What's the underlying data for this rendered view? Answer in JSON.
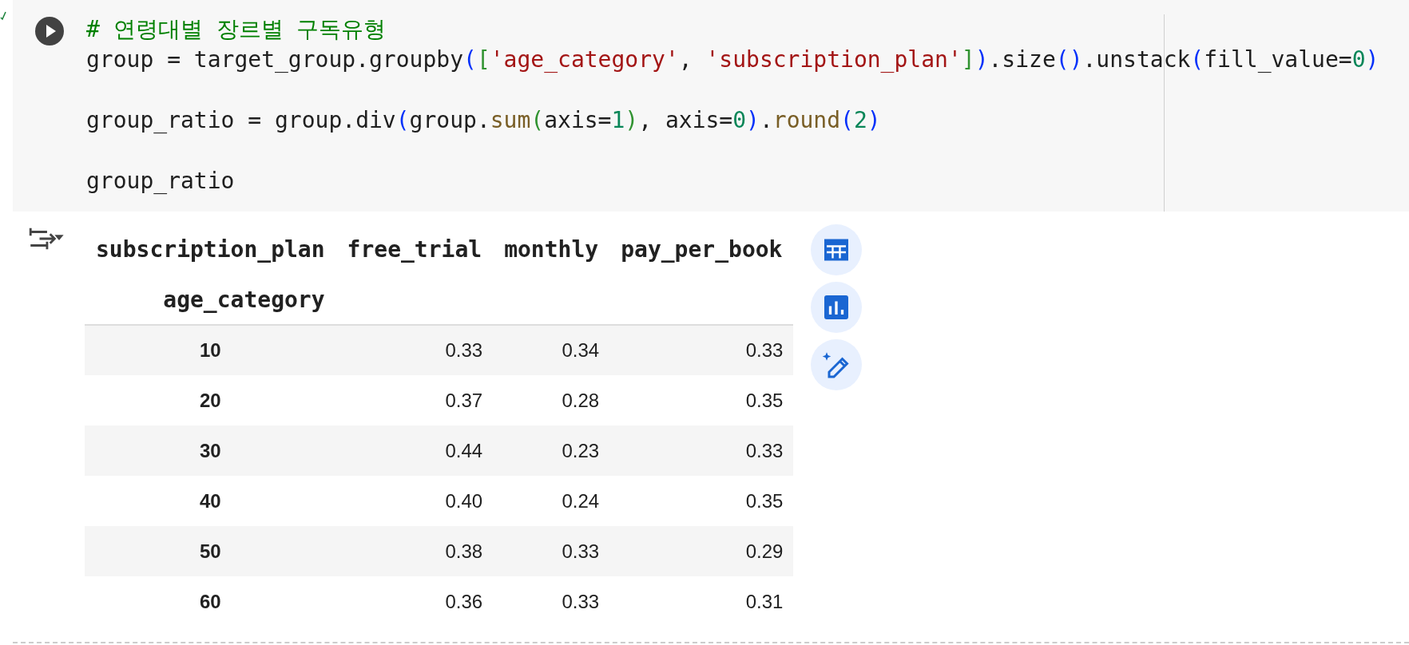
{
  "code_cell": {
    "lines": [
      {
        "kind": "code",
        "tokens": [
          {
            "kind": "comment",
            "text": "# 연령대별 장르별 구독유형"
          }
        ]
      },
      {
        "kind": "code",
        "tokens": [
          {
            "kind": "plain",
            "text": "group = target_group.groupby"
          },
          {
            "kind": "paren",
            "text": "("
          },
          {
            "kind": "bracket",
            "text": "["
          },
          {
            "kind": "string",
            "text": "'age_category'"
          },
          {
            "kind": "plain",
            "text": ", "
          },
          {
            "kind": "string",
            "text": "'subscription_plan'"
          },
          {
            "kind": "bracket",
            "text": "]"
          },
          {
            "kind": "paren",
            "text": ")"
          },
          {
            "kind": "plain",
            "text": ".size"
          },
          {
            "kind": "paren",
            "text": "()"
          },
          {
            "kind": "plain",
            "text": ".unstack"
          },
          {
            "kind": "paren",
            "text": "("
          },
          {
            "kind": "plain",
            "text": "fill_value="
          },
          {
            "kind": "number",
            "text": "0"
          },
          {
            "kind": "paren",
            "text": ")"
          }
        ]
      },
      {
        "kind": "blank"
      },
      {
        "kind": "code",
        "tokens": [
          {
            "kind": "plain",
            "text": "group_ratio = group.div"
          },
          {
            "kind": "paren",
            "text": "("
          },
          {
            "kind": "plain",
            "text": "group."
          },
          {
            "kind": "func",
            "text": "sum"
          },
          {
            "kind": "bracket",
            "text": "("
          },
          {
            "kind": "plain",
            "text": "axis="
          },
          {
            "kind": "number",
            "text": "1"
          },
          {
            "kind": "bracket",
            "text": ")"
          },
          {
            "kind": "plain",
            "text": ", axis="
          },
          {
            "kind": "number",
            "text": "0"
          },
          {
            "kind": "paren",
            "text": ")"
          },
          {
            "kind": "plain",
            "text": "."
          },
          {
            "kind": "func",
            "text": "round"
          },
          {
            "kind": "paren",
            "text": "("
          },
          {
            "kind": "number",
            "text": "2"
          },
          {
            "kind": "paren",
            "text": ")"
          }
        ]
      },
      {
        "kind": "blank"
      },
      {
        "kind": "code",
        "tokens": [
          {
            "kind": "plain",
            "text": "group_ratio"
          }
        ]
      }
    ]
  },
  "output_table": {
    "columns_name": "subscription_plan",
    "index_name": "age_category",
    "columns": [
      "free_trial",
      "monthly",
      "pay_per_book"
    ],
    "rows": [
      {
        "index": "10",
        "values": [
          "0.33",
          "0.34",
          "0.33"
        ]
      },
      {
        "index": "20",
        "values": [
          "0.37",
          "0.28",
          "0.35"
        ]
      },
      {
        "index": "30",
        "values": [
          "0.44",
          "0.23",
          "0.33"
        ]
      },
      {
        "index": "40",
        "values": [
          "0.40",
          "0.24",
          "0.35"
        ]
      },
      {
        "index": "50",
        "values": [
          "0.38",
          "0.33",
          "0.29"
        ]
      },
      {
        "index": "60",
        "values": [
          "0.36",
          "0.33",
          "0.31"
        ]
      }
    ]
  }
}
